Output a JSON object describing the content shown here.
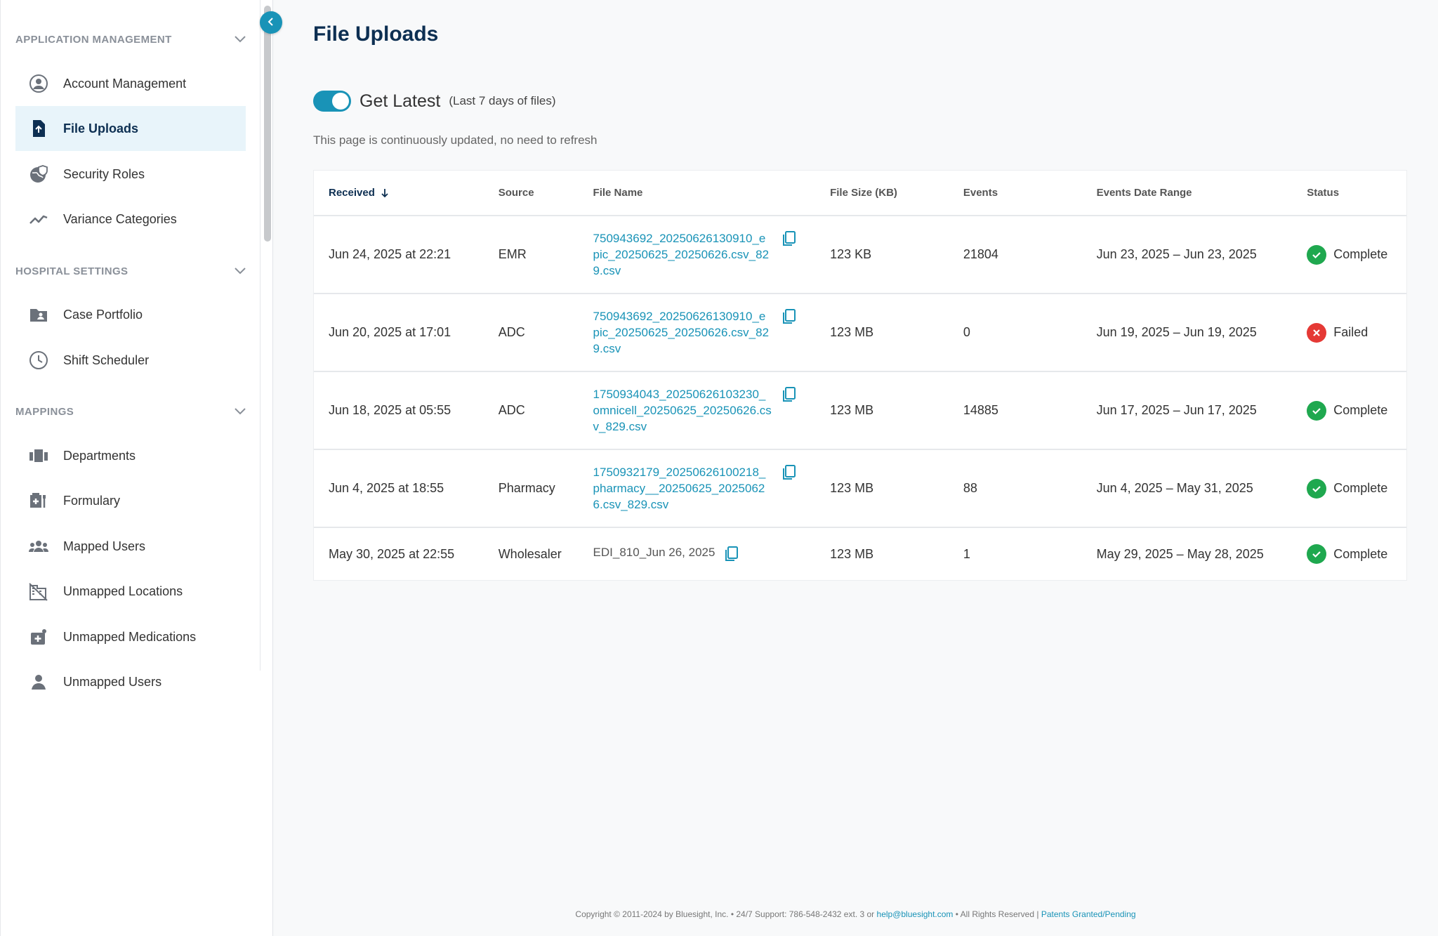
{
  "sidebar": {
    "sections": [
      {
        "label": "APPLICATION MANAGEMENT"
      },
      {
        "label": "HOSPITAL SETTINGS"
      },
      {
        "label": "MAPPINGS"
      }
    ],
    "items": [
      {
        "label": "Account Management",
        "icon": "account-circle-icon"
      },
      {
        "label": "File Uploads",
        "icon": "file-upload-icon",
        "active": true
      },
      {
        "label": "Security Roles",
        "icon": "security-globe-icon"
      },
      {
        "label": "Variance Categories",
        "icon": "trend-line-icon"
      },
      {
        "label": "Case Portfolio",
        "icon": "folder-person-icon"
      },
      {
        "label": "Shift Scheduler",
        "icon": "clock-icon"
      },
      {
        "label": "Departments",
        "icon": "departments-icon"
      },
      {
        "label": "Formulary",
        "icon": "formulary-icon"
      },
      {
        "label": "Mapped Users",
        "icon": "users-group-icon"
      },
      {
        "label": "Unmapped Locations",
        "icon": "unmapped-location-icon"
      },
      {
        "label": "Unmapped Medications",
        "icon": "unmapped-medication-icon"
      },
      {
        "label": "Unmapped Users",
        "icon": "user-icon"
      }
    ]
  },
  "header": {
    "title": "File Uploads",
    "toggle_label": "Get Latest",
    "toggle_sub": "(Last 7 days of files)",
    "toggle_on": true,
    "refresh_note": "This page is continuously updated, no need to refresh"
  },
  "table": {
    "columns": [
      "Received",
      "Source",
      "File Name",
      "File Size (KB)",
      "Events",
      "Events Date Range",
      "Status"
    ],
    "rows": [
      {
        "received": "Jun 24, 2025 at 22:21",
        "source": "EMR",
        "file": "750943692_20250626130910_epic_20250625_20250626.csv_829.csv",
        "file_link": true,
        "size": "123 KB",
        "events": "21804",
        "range": "Jun 23, 2025 – Jun 23, 2025",
        "status": "Complete",
        "status_type": "ok"
      },
      {
        "received": "Jun 20, 2025 at 17:01",
        "source": "ADC",
        "file": "750943692_20250626130910_epic_20250625_20250626.csv_829.csv",
        "file_link": true,
        "size": "123 MB",
        "events": "0",
        "range": "Jun 19, 2025 – Jun 19, 2025",
        "status": "Failed",
        "status_type": "fail"
      },
      {
        "received": "Jun 18, 2025 at 05:55",
        "source": "ADC",
        "file": "1750934043_20250626103230_omnicell_20250625_20250626.csv_829.csv",
        "file_link": true,
        "size": "123 MB",
        "events": "14885",
        "range": "Jun 17, 2025 – Jun 17, 2025",
        "status": "Complete",
        "status_type": "ok"
      },
      {
        "received": "Jun 4, 2025 at 18:55",
        "source": "Pharmacy",
        "file": "1750932179_20250626100218_pharmacy__20250625_20250626.csv_829.csv",
        "file_link": true,
        "size": "123 MB",
        "events": "88",
        "range": "Jun 4, 2025 – May 31, 2025",
        "status": "Complete",
        "status_type": "ok"
      },
      {
        "received": "May 30, 2025 at 22:55",
        "source": "Wholesaler",
        "file": "EDI_810_Jun 26, 2025",
        "file_link": false,
        "size": "123 MB",
        "events": "1",
        "range": "May 29, 2025 – May 28, 2025",
        "status": "Complete",
        "status_type": "ok"
      }
    ]
  },
  "footer": {
    "text": "Copyright © 2011-2024 by Bluesight, Inc. • 24/7 Support: 786-548-2432 ext. 3 or",
    "email": "help@bluesight.com",
    "rights": "• All Rights Reserved |",
    "patents": "Patents Granted/Pending"
  },
  "colors": {
    "accent": "#1993b7",
    "title": "#0d2f52",
    "success": "#1fa84f",
    "error": "#e53935"
  }
}
